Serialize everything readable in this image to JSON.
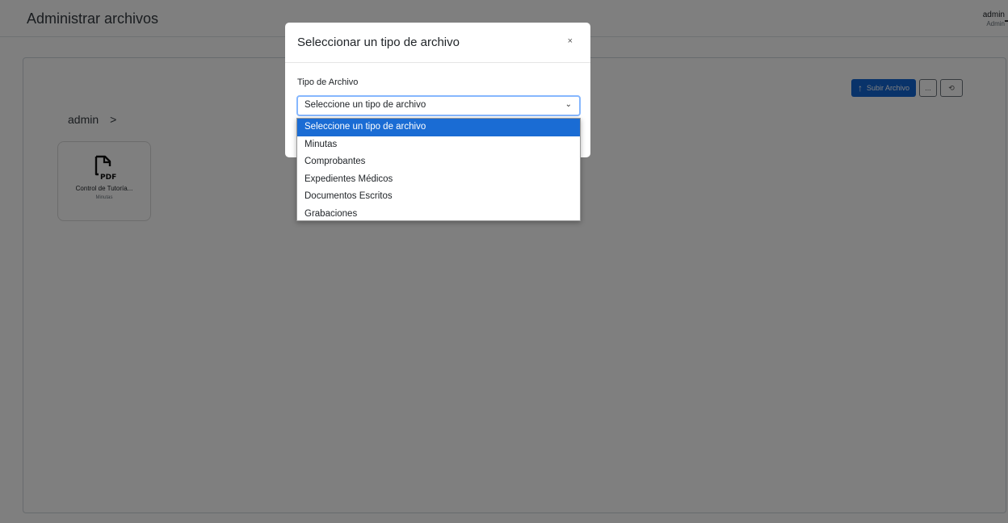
{
  "header": {
    "title": "Administrar archivos",
    "user_name": "admin",
    "user_role": "Admin"
  },
  "breadcrumb": {
    "root": "admin",
    "separator": ">"
  },
  "files": [
    {
      "name": "Control de Tutoría...",
      "type": "Minutas",
      "icon": "pdf-file-icon"
    }
  ],
  "toolbar": {
    "upload_label": "Subir Archivo",
    "upload_icon": "up-arrow-icon",
    "more_label": "...",
    "history_icon": "history-icon"
  },
  "modal": {
    "title": "Seleccionar un tipo de archivo",
    "close_label": "×",
    "field_label": "Tipo de Archivo",
    "select_value": "Seleccione un tipo de archivo",
    "options": [
      "Seleccione un tipo de archivo",
      "Minutas",
      "Comprobantes",
      "Expedientes Médicos",
      "Documentos Escritos",
      "Grabaciones"
    ],
    "highlighted_option_index": 0
  },
  "colors": {
    "primary": "#1266d4",
    "highlight": "#1a6cd4",
    "backdrop": "rgba(0,0,0,0.5)"
  }
}
